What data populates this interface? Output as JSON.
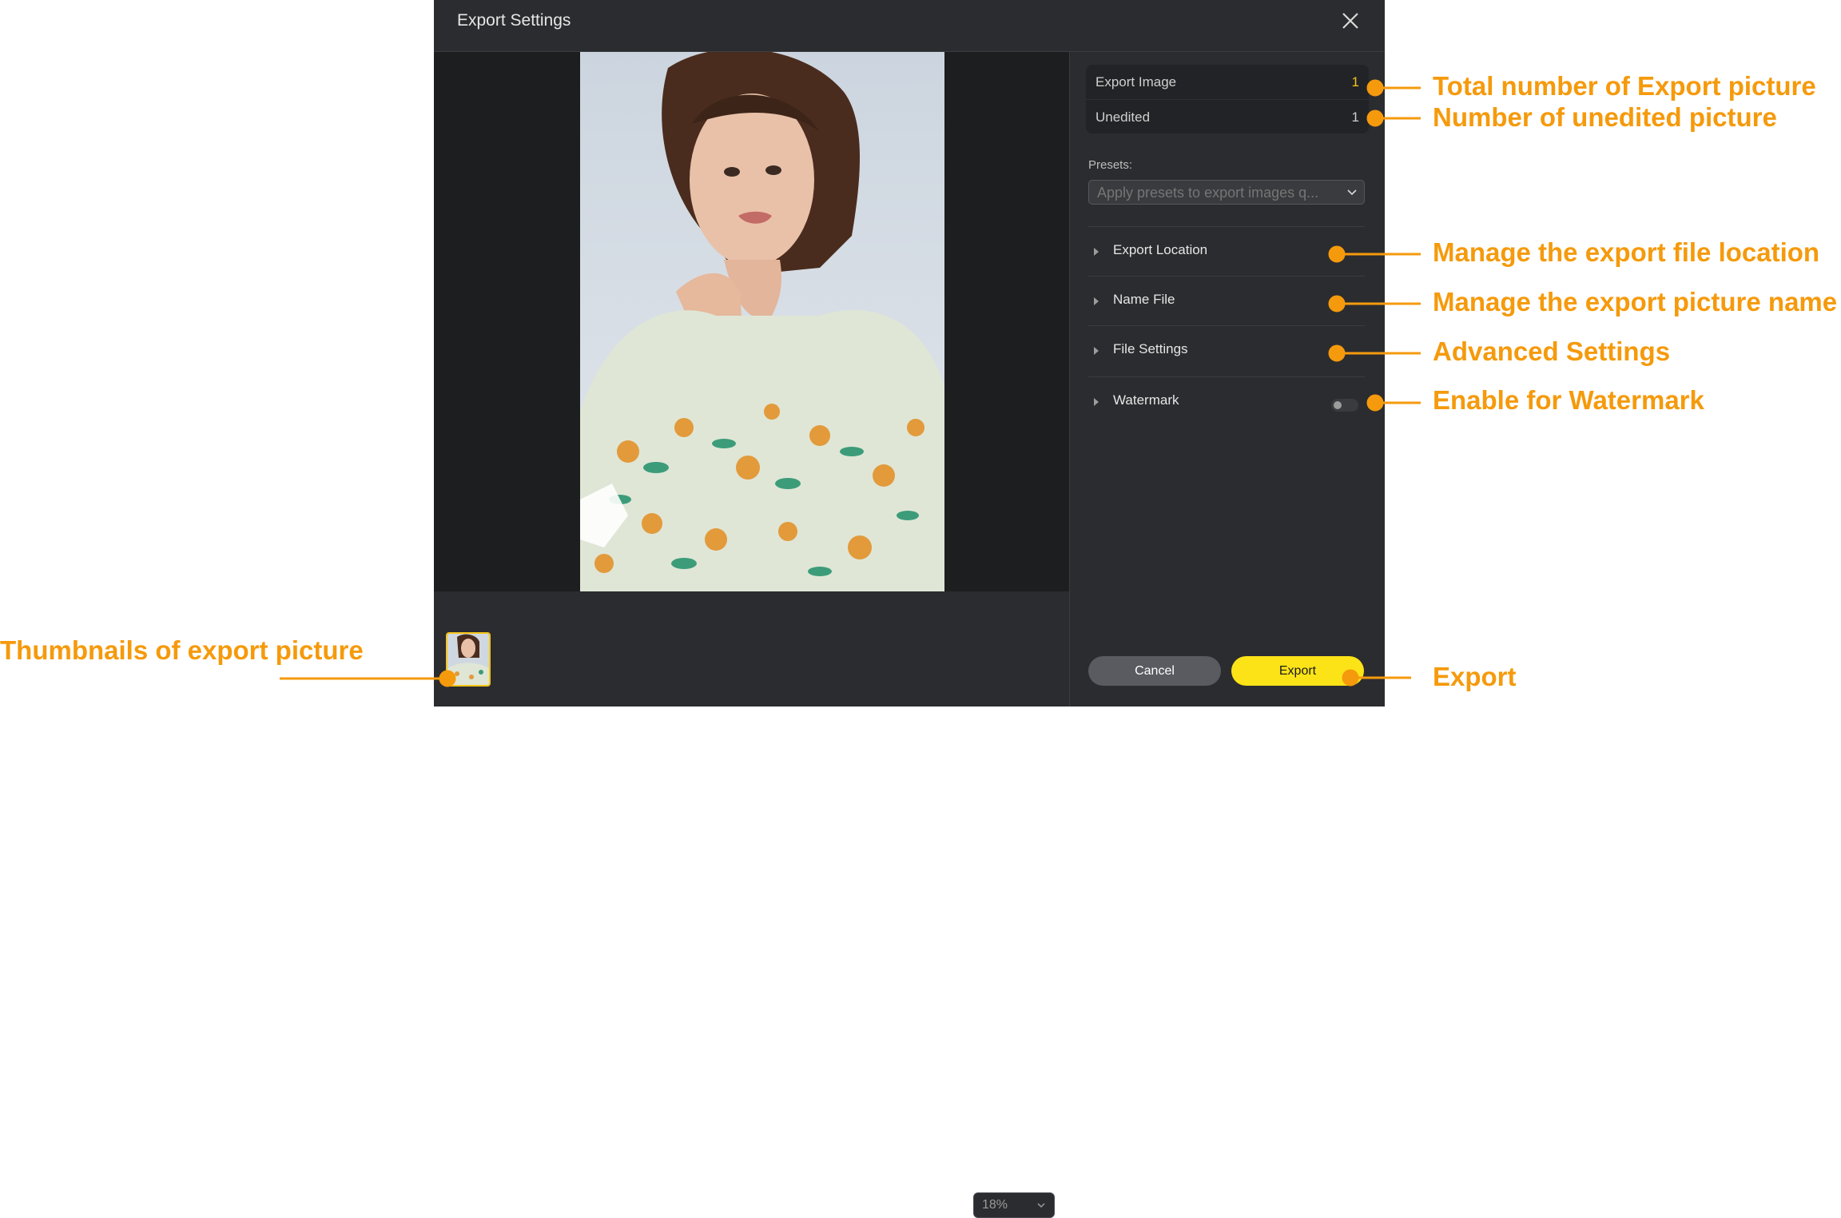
{
  "dialog": {
    "title": "Export Settings",
    "close_icon": "close-icon"
  },
  "preview": {
    "zoom": "18%"
  },
  "side": {
    "export_image_label": "Export Image",
    "export_image_count": "1",
    "unedited_label": "Unedited",
    "unedited_count": "1",
    "presets_label": "Presets:",
    "presets_placeholder": "Apply presets to export images q...",
    "sections": [
      {
        "label": "Export Location"
      },
      {
        "label": "Name File"
      },
      {
        "label": "File Settings"
      },
      {
        "label": "Watermark"
      }
    ],
    "watermark_enabled": false
  },
  "buttons": {
    "cancel": "Cancel",
    "export": "Export"
  },
  "annotations": {
    "total_export": "Total number of Export picture",
    "unedited": "Number of unedited picture",
    "location": "Manage the export file location",
    "name": "Manage the export picture name",
    "advanced": "Advanced Settings",
    "watermark": "Enable for Watermark",
    "thumbnails": "Thumbnails of export picture",
    "export": "Export"
  },
  "colors": {
    "accent": "#fce318",
    "annotation": "#f59a0c",
    "dialog_bg": "#2b2c2f",
    "preview_bg": "#1d1e20"
  }
}
